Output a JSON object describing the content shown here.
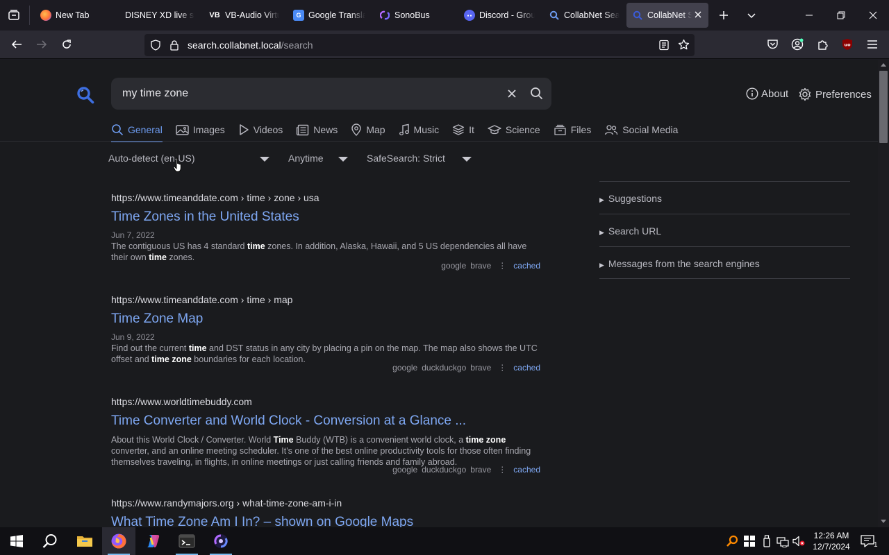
{
  "tabs": [
    {
      "label": "New Tab",
      "icon": "firefox-icon"
    },
    {
      "label": "DISNEY XD live stre",
      "icon": "none"
    },
    {
      "label": "VB-Audio Virtu",
      "icon": "vb-audio-icon",
      "icon_text": "VB"
    },
    {
      "label": "Google Transla",
      "icon": "google-translate-icon"
    },
    {
      "label": "SonoBus",
      "icon": "sonobus-icon"
    },
    {
      "label": "Discord - Grou",
      "icon": "discord-icon"
    },
    {
      "label": "CollabNet Sea",
      "icon": "search-icon"
    },
    {
      "label": "CollabNet S",
      "icon": "search-icon",
      "active": true
    }
  ],
  "navbar": {
    "url_host": "search.collabnet.local",
    "url_path": "/search"
  },
  "search": {
    "query": "my time zone"
  },
  "header_links": {
    "about": "About",
    "preferences": "Preferences"
  },
  "categories": [
    {
      "label": "General",
      "icon": "search-icon",
      "active": true
    },
    {
      "label": "Images",
      "icon": "image-icon"
    },
    {
      "label": "Videos",
      "icon": "play-icon"
    },
    {
      "label": "News",
      "icon": "newspaper-icon"
    },
    {
      "label": "Map",
      "icon": "map-pin-icon"
    },
    {
      "label": "Music",
      "icon": "music-note-icon"
    },
    {
      "label": "It",
      "icon": "layers-icon"
    },
    {
      "label": "Science",
      "icon": "graduation-cap-icon"
    },
    {
      "label": "Files",
      "icon": "archive-icon"
    },
    {
      "label": "Social Media",
      "icon": "people-icon"
    }
  ],
  "filters": {
    "language": "Auto-detect (en-US)",
    "time": "Anytime",
    "safesearch": "SafeSearch: Strict"
  },
  "results": [
    {
      "url": "https://www.timeanddate.com",
      "path": " › time › zone › usa",
      "title": "Time Zones in the United States",
      "date": "Jun 7, 2022",
      "desc_parts": [
        {
          "t": "The contiguous US has 4 standard ",
          "b": false
        },
        {
          "t": "time",
          "b": true
        },
        {
          "t": " zones. In addition, Alaska, Hawaii, and 5 US dependencies all have their own ",
          "b": false
        },
        {
          "t": "time",
          "b": true
        },
        {
          "t": " zones.",
          "b": false
        }
      ],
      "engines": [
        "google",
        "brave"
      ],
      "cached": "cached"
    },
    {
      "url": "https://www.timeanddate.com",
      "path": " › time › map",
      "title": "Time Zone Map",
      "date": "Jun 9, 2022",
      "desc_parts": [
        {
          "t": "Find out the current ",
          "b": false
        },
        {
          "t": "time",
          "b": true
        },
        {
          "t": " and DST status in any city by placing a pin on the map. The map also shows the UTC offset and ",
          "b": false
        },
        {
          "t": "time zone",
          "b": true
        },
        {
          "t": " boundaries for each location.",
          "b": false
        }
      ],
      "engines": [
        "google",
        "duckduckgo",
        "brave"
      ],
      "cached": "cached"
    },
    {
      "url": "https://www.worldtimebuddy.com",
      "path": "",
      "title": "Time Converter and World Clock - Conversion at a Glance ...",
      "date": "",
      "desc_parts": [
        {
          "t": "About this World Clock / Converter. World ",
          "b": false
        },
        {
          "t": "Time",
          "b": true
        },
        {
          "t": " Buddy (WTB) is a convenient world clock, a ",
          "b": false
        },
        {
          "t": "time zone",
          "b": true
        },
        {
          "t": " converter, and an online meeting scheduler. It's one of the best online productivity tools for those often finding themselves traveling, in flights, in online meetings or just calling friends and family abroad.",
          "b": false
        }
      ],
      "engines": [
        "google",
        "duckduckgo",
        "brave"
      ],
      "cached": "cached"
    },
    {
      "url": "https://www.randymajors.org",
      "path": " › what-time-zone-am-i-in",
      "title": "What Time Zone Am I In? – shown on Google Maps",
      "date": "",
      "desc_parts": [],
      "engines": [],
      "cached": ""
    }
  ],
  "sidebar": {
    "suggestions": "Suggestions",
    "search_url": "Search URL",
    "messages": "Messages from the search engines"
  },
  "taskbar": {
    "time": "12:26 AM",
    "date": "12/7/2024",
    "notification_count": "1"
  },
  "colors": {
    "accent": "#6d9bef",
    "link": "#7ea7f2",
    "page_bg": "#1a1b1e",
    "ublock": "#c8102e"
  }
}
